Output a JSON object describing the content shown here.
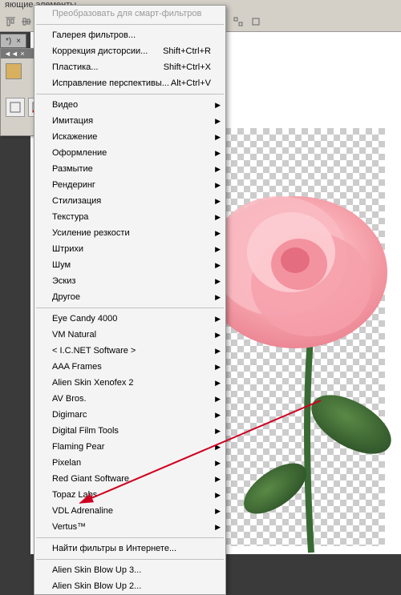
{
  "menubar_fragment": "яющие элементы",
  "tab_marker": "*)",
  "panel_title": "◄◄ ×",
  "menu": {
    "top_disabled": "Преобразовать для смарт-фильтров",
    "group1": [
      {
        "label": "Галерея фильтров..."
      },
      {
        "label": "Коррекция дисторсии...",
        "shortcut": "Shift+Ctrl+R"
      },
      {
        "label": "Пластика...",
        "shortcut": "Shift+Ctrl+X"
      },
      {
        "label": "Исправление перспективы...",
        "shortcut": "Alt+Ctrl+V"
      }
    ],
    "group2": [
      "Видео",
      "Имитация",
      "Искажение",
      "Оформление",
      "Размытие",
      "Рендеринг",
      "Стилизация",
      "Текстура",
      "Усиление резкости",
      "Штрихи",
      "Шум",
      "Эскиз",
      "Другое"
    ],
    "group3": [
      "Eye Candy 4000",
      "VM Natural",
      "< I.C.NET Software >",
      "AAA Frames",
      "Alien Skin Xenofex 2",
      "AV Bros.",
      "Digimarc",
      "Digital Film Tools",
      "Flaming Pear",
      "Pixelan",
      "Red Giant Software",
      "Topaz Labs",
      "VDL Adrenaline",
      "Vertus™"
    ],
    "group4": [
      "Найти фильтры в Интернете..."
    ],
    "group5": [
      "Alien Skin Blow Up 3...",
      "Alien Skin Blow Up 2..."
    ]
  }
}
